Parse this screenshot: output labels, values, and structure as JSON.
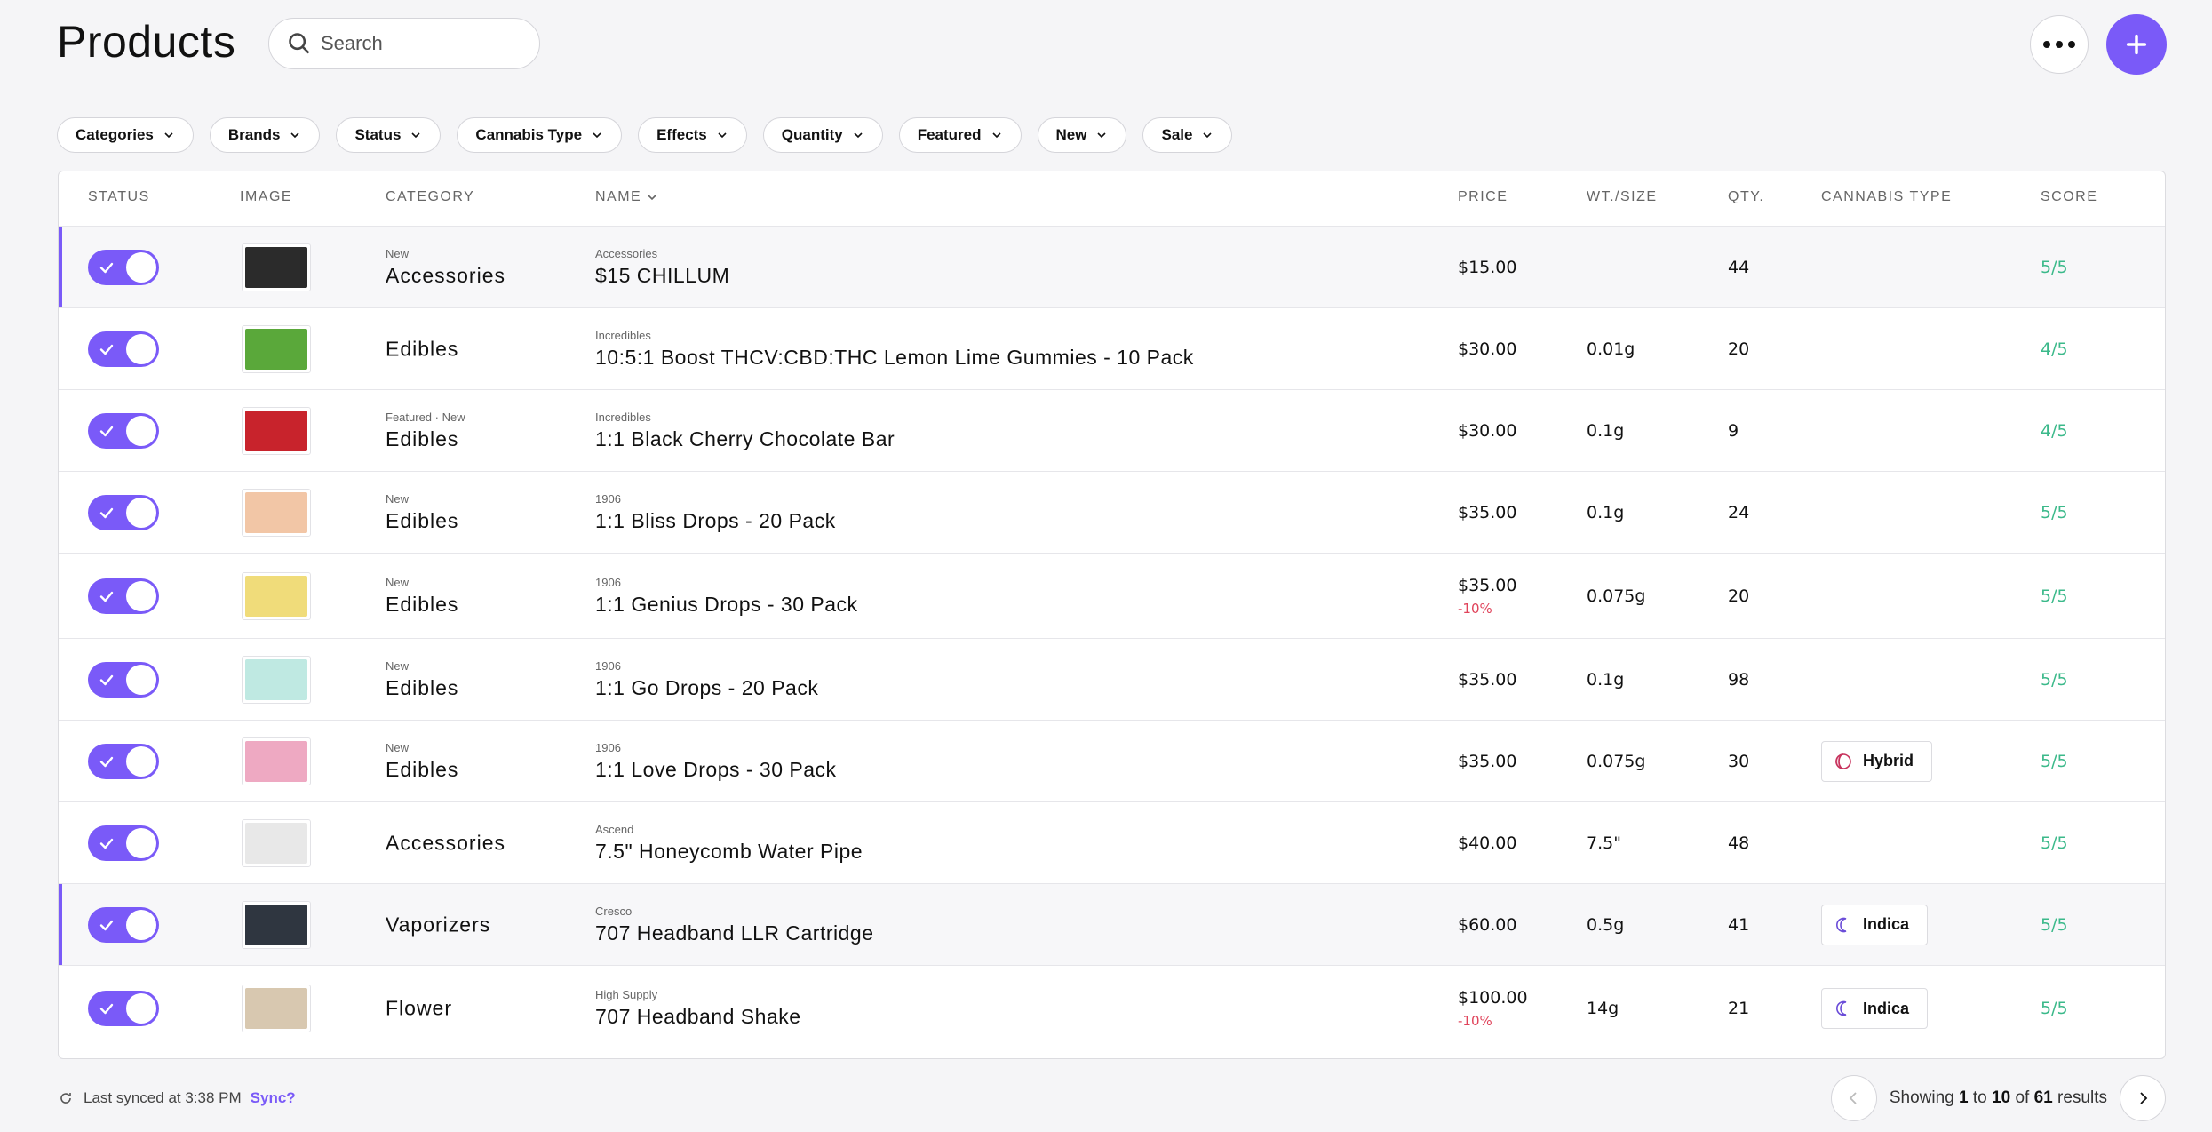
{
  "header": {
    "title": "Products",
    "search_placeholder": "Search",
    "accent": "#7a5af8"
  },
  "filters": [
    "Categories",
    "Brands",
    "Status",
    "Cannabis Type",
    "Effects",
    "Quantity",
    "Featured",
    "New",
    "Sale"
  ],
  "table": {
    "columns": {
      "status": "STATUS",
      "image": "IMAGE",
      "category": "CATEGORY",
      "name": "NAME",
      "price": "PRICE",
      "wt": "WT./SIZE",
      "qty": "QTY.",
      "type": "CANNABIS TYPE",
      "score": "SCORE"
    },
    "rows": [
      {
        "enabled": true,
        "tag": "New",
        "category": "Accessories",
        "brand": "Accessories",
        "name": "$15 CHILLUM",
        "price": "$15.00",
        "discount": "",
        "wt": "",
        "qty": "44",
        "type": "",
        "score": "5/5",
        "thumb": "#2b2b2b"
      },
      {
        "enabled": true,
        "tag": "",
        "category": "Edibles",
        "brand": "Incredibles",
        "name": "10:5:1 Boost THCV:CBD:THC Lemon Lime Gummies - 10 Pack",
        "price": "$30.00",
        "discount": "",
        "wt": "0.01g",
        "qty": "20",
        "type": "",
        "score": "4/5",
        "thumb": "#5aa83a"
      },
      {
        "enabled": true,
        "tag": "Featured · New",
        "category": "Edibles",
        "brand": "Incredibles",
        "name": "1:1 Black Cherry Chocolate Bar",
        "price": "$30.00",
        "discount": "",
        "wt": "0.1g",
        "qty": "9",
        "type": "",
        "score": "4/5",
        "thumb": "#c8232c"
      },
      {
        "enabled": true,
        "tag": "New",
        "category": "Edibles",
        "brand": "1906",
        "name": "1:1 Bliss Drops - 20 Pack",
        "price": "$35.00",
        "discount": "",
        "wt": "0.1g",
        "qty": "24",
        "type": "",
        "score": "5/5",
        "thumb": "#f2c6a6"
      },
      {
        "enabled": true,
        "tag": "New",
        "category": "Edibles",
        "brand": "1906",
        "name": "1:1 Genius Drops - 30 Pack",
        "price": "$35.00",
        "discount": "-10%",
        "wt": "0.075g",
        "qty": "20",
        "type": "",
        "score": "5/5",
        "thumb": "#f0dc7a"
      },
      {
        "enabled": true,
        "tag": "New",
        "category": "Edibles",
        "brand": "1906",
        "name": "1:1 Go Drops - 20 Pack",
        "price": "$35.00",
        "discount": "",
        "wt": "0.1g",
        "qty": "98",
        "type": "",
        "score": "5/5",
        "thumb": "#bfe9e2"
      },
      {
        "enabled": true,
        "tag": "New",
        "category": "Edibles",
        "brand": "1906",
        "name": "1:1 Love Drops - 30 Pack",
        "price": "$35.00",
        "discount": "",
        "wt": "0.075g",
        "qty": "30",
        "type": "Hybrid",
        "score": "5/5",
        "thumb": "#eea9c2"
      },
      {
        "enabled": true,
        "tag": "",
        "category": "Accessories",
        "brand": "Ascend",
        "name": "7.5\" Honeycomb Water Pipe",
        "price": "$40.00",
        "discount": "",
        "wt": "7.5\"",
        "qty": "48",
        "type": "",
        "score": "5/5",
        "thumb": "#e8e8e8"
      },
      {
        "enabled": true,
        "tag": "",
        "category": "Vaporizers",
        "brand": "Cresco",
        "name": "707 Headband LLR Cartridge",
        "price": "$60.00",
        "discount": "",
        "wt": "0.5g",
        "qty": "41",
        "type": "Indica",
        "score": "5/5",
        "thumb": "#2f3640"
      },
      {
        "enabled": true,
        "tag": "",
        "category": "Flower",
        "brand": "High Supply",
        "name": "707 Headband Shake",
        "price": "$100.00",
        "discount": "-10%",
        "wt": "14g",
        "qty": "21",
        "type": "Indica",
        "score": "5/5",
        "thumb": "#d8c8b0"
      }
    ]
  },
  "footer": {
    "synced_text": "Last synced at 3:38 PM",
    "sync_link": "Sync?",
    "showing": "Showing",
    "from": "1",
    "to_word": "to",
    "to": "10",
    "of_word": "of",
    "total": "61",
    "results_word": "results"
  }
}
